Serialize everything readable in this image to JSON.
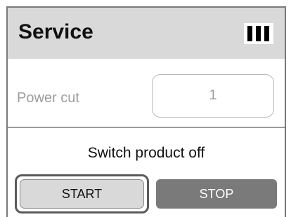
{
  "header": {
    "title": "Service",
    "icon": "signal-bars-icon"
  },
  "power_cut": {
    "label": "Power cut",
    "value": "1"
  },
  "prompt": "Switch product off",
  "buttons": {
    "start_label": "START",
    "stop_label": "STOP"
  },
  "colors": {
    "header_bg": "#d9d9d9",
    "label_text": "#9d9d9d",
    "start_bg": "#d9d9d9",
    "stop_bg": "#7a7a7a"
  }
}
